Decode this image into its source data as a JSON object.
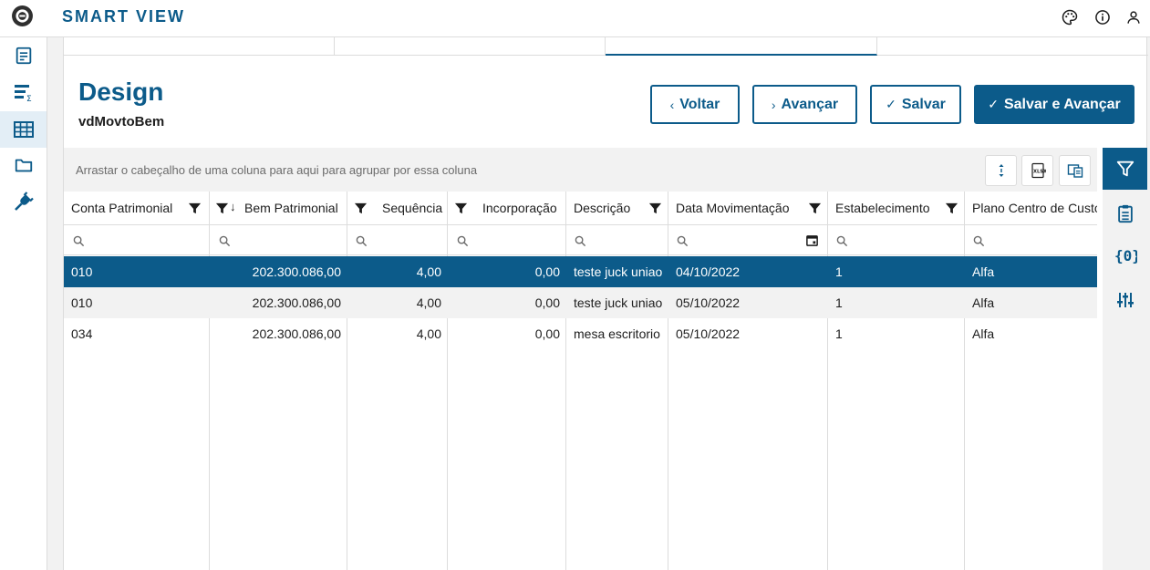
{
  "header": {
    "app_title": "SMART VIEW"
  },
  "icons": {
    "logo": "totvs-logo-icon",
    "theme": "palette-icon",
    "info": "info-icon",
    "user": "user-icon"
  },
  "leftnav": [
    "report-icon",
    "analysis-icon",
    "table-icon",
    "folder-icon",
    "plug-icon"
  ],
  "page": {
    "title": "Design",
    "subtitle": "vdMovtoBem"
  },
  "buttons": {
    "back": "Voltar",
    "next": "Avançar",
    "save": "Salvar",
    "save_next": "Salvar e Avançar"
  },
  "grid": {
    "group_hint": "Arrastar o cabeçalho de uma coluna para aqui para agrupar por essa coluna",
    "columns": [
      "Conta Patrimonial",
      "Bem Patrimonial",
      "Sequência",
      "Incorporação",
      "Descrição",
      "Data Movimentação",
      "Estabelecimento",
      "Plano Centro de Custo"
    ],
    "rows": [
      [
        "010",
        "202.300.086,00",
        "4,00",
        "0,00",
        "teste juck uniao",
        "04/10/2022",
        "1",
        "Alfa"
      ],
      [
        "010",
        "202.300.086,00",
        "4,00",
        "0,00",
        "teste juck uniao",
        "05/10/2022",
        "1",
        "Alfa"
      ],
      [
        "034",
        "202.300.086,00",
        "4,00",
        "0,00",
        "mesa escritorio",
        "05/10/2022",
        "1",
        "Alfa"
      ]
    ]
  },
  "colors": {
    "accent": "#0c5b8a",
    "selected_row": "#0c5b8a",
    "alt_row": "#f2f2f2"
  }
}
